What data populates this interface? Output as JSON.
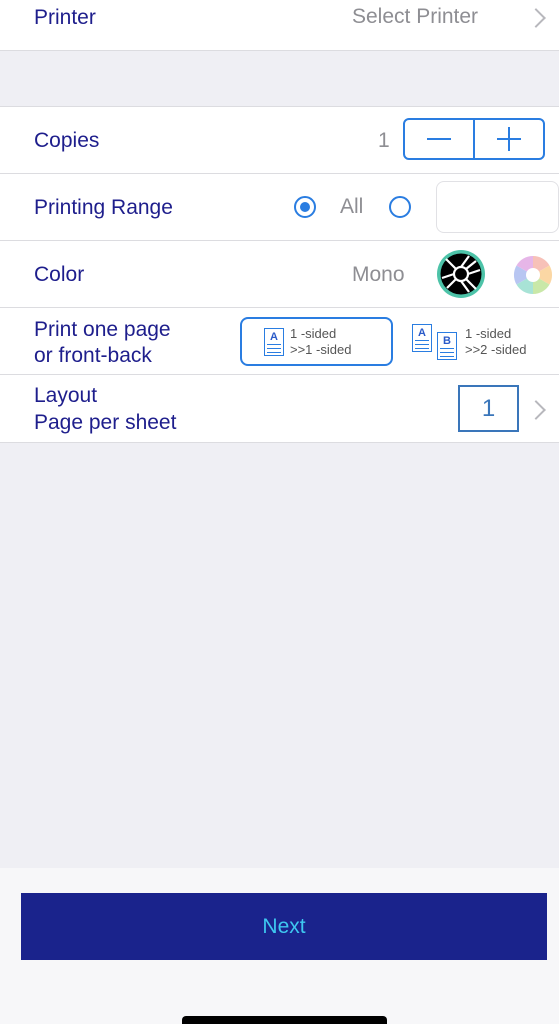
{
  "printer": {
    "label": "Printer",
    "value": "Select Printer"
  },
  "copies": {
    "label": "Copies",
    "value": "1"
  },
  "printing_range": {
    "label": "Printing Range",
    "option_all": "All",
    "selected": "All",
    "range_value": ""
  },
  "color": {
    "label": "Color",
    "value": "Mono"
  },
  "sided": {
    "label_line1": "Print one page",
    "label_line2": "or front-back",
    "option1_line1": "1 -sided",
    "option1_line2": ">>1 -sided",
    "option2_line1": "1 -sided",
    "option2_line2": ">>2 -sided",
    "doc_a": "A",
    "doc_b": "B",
    "selected": "1 -sided >>1 -sided"
  },
  "layout": {
    "label_line1": "Layout",
    "label_line2": "Page per sheet",
    "value": "1"
  },
  "next_button": {
    "label": "Next"
  },
  "colors": {
    "accent": "#2a7de1",
    "label": "#1e1e8c",
    "button_bg": "#1a238c",
    "button_text": "#3ec7f0"
  }
}
